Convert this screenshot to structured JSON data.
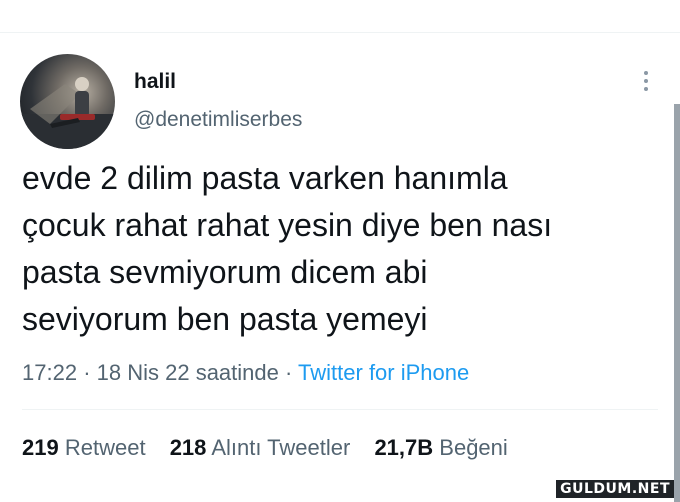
{
  "tweet": {
    "author": {
      "display_name": "halil",
      "handle": "@denetimliserbes"
    },
    "text_lines": [
      "evde 2 dilim pasta varken hanımla",
      "çocuk rahat rahat yesin diye ben nası",
      "pasta sevmiyorum dicem abi",
      "seviyorum ben pasta yemeyi"
    ],
    "meta": {
      "time": "17:22",
      "separator": "·",
      "date": "18 Nis 22 saatinde",
      "source": "Twitter for iPhone"
    },
    "stats": [
      {
        "count": "219",
        "label": "Retweet"
      },
      {
        "count": "218",
        "label": "Alıntı Tweetler"
      },
      {
        "count": "21,7B",
        "label": "Beğeni"
      }
    ]
  },
  "icons": {
    "more": "more-vertical-icon"
  },
  "watermark": "GULDUM.NET",
  "colors": {
    "text": "#0f1419",
    "secondary": "#536471",
    "link": "#1d9bf0"
  }
}
